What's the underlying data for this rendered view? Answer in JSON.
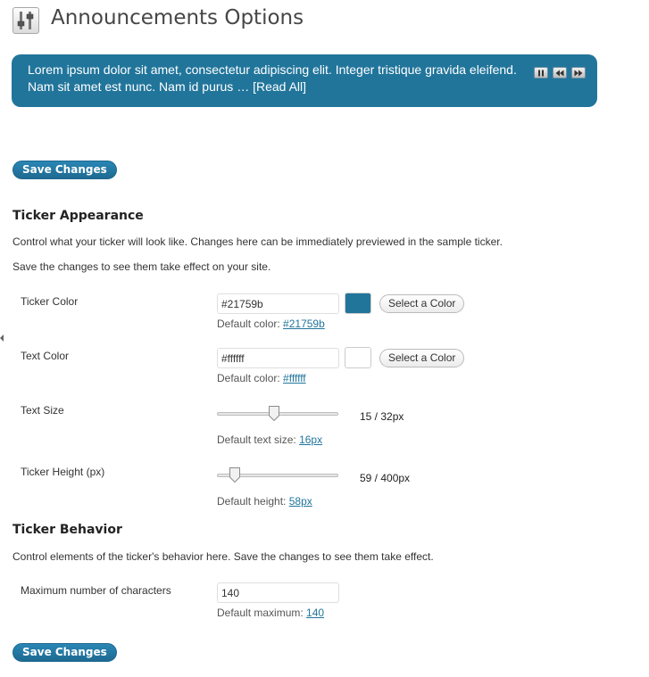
{
  "page": {
    "title": "Announcements Options"
  },
  "ticker": {
    "text": "Lorem ipsum dolor sit amet, consectetur adipiscing elit. Integer tristique gravida eleifend. Nam sit amet est nunc. Nam id purus …",
    "read_all": "[Read All]",
    "background_color": "#21759b",
    "text_color": "#ffffff",
    "controls": [
      "pause-icon",
      "rewind-icon",
      "fast-forward-icon"
    ]
  },
  "save_button": {
    "label": "Save Changes"
  },
  "appearance": {
    "heading": "Ticker Appearance",
    "desc1": "Control what your ticker will look like. Changes here can be immediately previewed in the sample ticker.",
    "desc2": "Save the changes to see them take effect on your site.",
    "ticker_color": {
      "label": "Ticker Color",
      "value": "#21759b",
      "swatch": "#21759b",
      "button": "Select a Color",
      "default_prefix": "Default color:",
      "default_value": "#21759b"
    },
    "text_color": {
      "label": "Text Color",
      "value": "#ffffff",
      "swatch": "#ffffff",
      "button": "Select a Color",
      "default_prefix": "Default color:",
      "default_value": "#ffffff"
    },
    "text_size": {
      "label": "Text Size",
      "value": 15,
      "max": 32,
      "readout": "15 / 32px",
      "default_prefix": "Default text size:",
      "default_value": "16px"
    },
    "ticker_height": {
      "label": "Ticker Height (px)",
      "value": 59,
      "max": 400,
      "readout": "59 / 400px",
      "default_prefix": "Default height:",
      "default_value": "58px"
    }
  },
  "behavior": {
    "heading": "Ticker Behavior",
    "desc": "Control elements of the ticker's behavior here. Save the changes to see them take effect.",
    "max_chars": {
      "label": "Maximum number of characters",
      "value": "140",
      "default_prefix": "Default maximum:",
      "default_value": "140"
    }
  }
}
